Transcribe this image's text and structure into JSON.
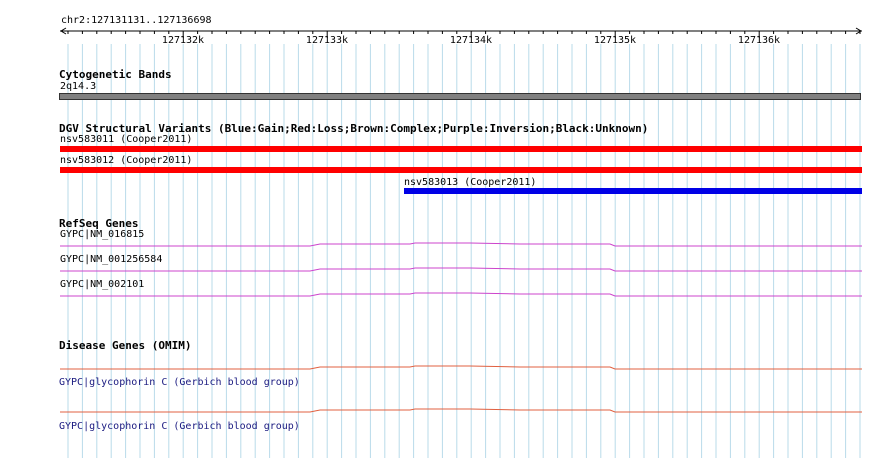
{
  "ruler": {
    "region": "chr2:127131131..127136698",
    "ticks": [
      "127132k",
      "127133k",
      "127134k",
      "127135k",
      "127136k"
    ]
  },
  "tracks": {
    "cytoband": {
      "title": "Cytogenetic Bands",
      "band": "2q14.3",
      "color": "#808080"
    },
    "dgv": {
      "title": "DGV Structural Variants (Blue:Gain;Red:Loss;Brown:Complex;Purple:Inversion;Black:Unknown)",
      "items": [
        {
          "label": "nsv583011 (Cooper2011)",
          "color": "#ff0000"
        },
        {
          "label": "nsv583012 (Cooper2011)",
          "color": "#ff0000"
        },
        {
          "label": "nsv583013 (Cooper2011)",
          "color": "#0000e6"
        }
      ]
    },
    "refseq": {
      "title": "RefSeq Genes",
      "items": [
        {
          "label": "GYPC|NM_016815",
          "color": "#cc44cc"
        },
        {
          "label": "GYPC|NM_001256584",
          "color": "#cc44cc"
        },
        {
          "label": "GYPC|NM_002101",
          "color": "#cc44cc"
        }
      ]
    },
    "omim": {
      "title": "Disease Genes (OMIM)",
      "items": [
        {
          "label": "GYPC|glycophorin C (Gerbich blood group)",
          "color": "#e06040"
        },
        {
          "label": "GYPC|glycophorin C (Gerbich blood group)",
          "color": "#e06040"
        }
      ]
    }
  }
}
